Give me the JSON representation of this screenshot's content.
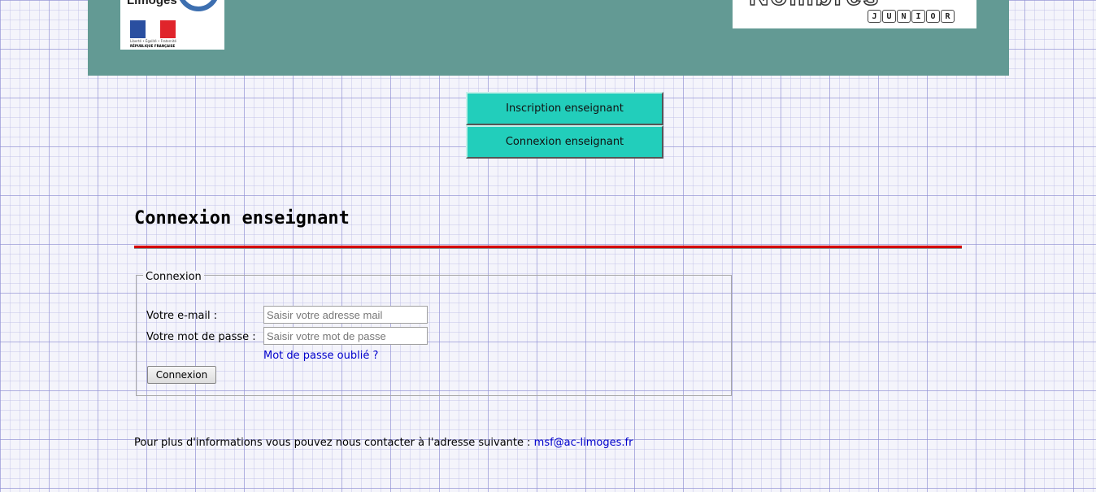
{
  "header": {
    "left_logo": {
      "word": "Limoges",
      "motto": "Liberté • Égalité • Fraternité",
      "republic": "RÉPUBLIQUE FRANÇAISE"
    },
    "right_logo": {
      "badge_letters": [
        "J",
        "U",
        "N",
        "I",
        "O",
        "R"
      ]
    },
    "colors": {
      "header_bg": "#639a94",
      "nav_button": "#22cebb",
      "rule": "#d40000",
      "link": "#0000cc"
    }
  },
  "nav": {
    "register_label": "Inscription enseignant",
    "login_label": "Connexion enseignant"
  },
  "page": {
    "title": "Connexion enseignant"
  },
  "form": {
    "legend": "Connexion",
    "email_label": "Votre e-mail :",
    "email_placeholder": "Saisir votre adresse mail",
    "email_value": "",
    "password_label": "Votre mot de passe :",
    "password_placeholder": "Saisir votre mot de passe",
    "password_value": "",
    "forgot_link": "Mot de passe oublié ?",
    "submit_label": "Connexion"
  },
  "footer": {
    "contact_text": "Pour plus d'informations vous pouvez nous contacter à l'adresse suivante : ",
    "contact_email": "msf@ac-limoges.fr"
  }
}
